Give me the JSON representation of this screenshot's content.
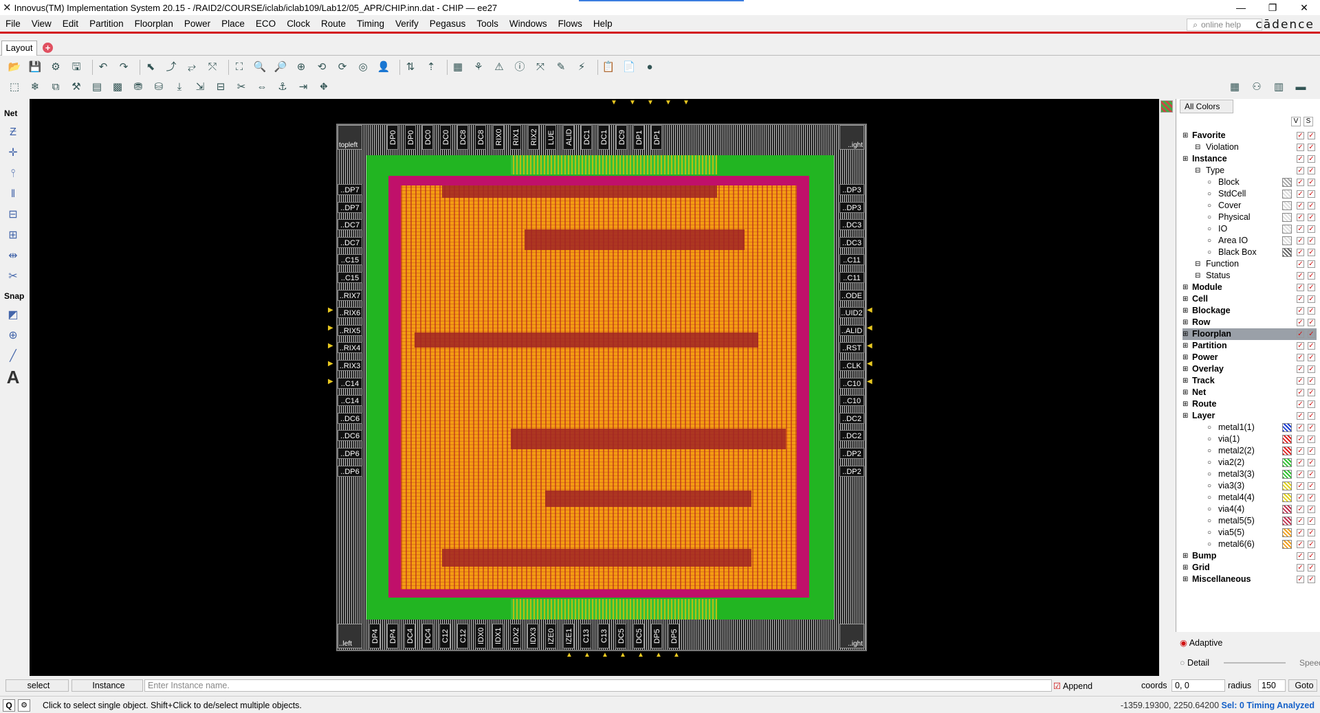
{
  "title": "Innovus(TM) Implementation System 20.15 - /RAID2/COURSE/iclab/iclab109/Lab12/05_APR/CHIP.inn.dat - CHIP — ee27",
  "window_controls": [
    "—",
    "❐",
    "✕"
  ],
  "menu": [
    "File",
    "View",
    "Edit",
    "Partition",
    "Floorplan",
    "Power",
    "Place",
    "ECO",
    "Clock",
    "Route",
    "Timing",
    "Verify",
    "Pegasus",
    "Tools",
    "Windows",
    "Flows",
    "Help"
  ],
  "search_placeholder": "online help",
  "brand": "cādence",
  "tab_label": "Layout",
  "left_labels": {
    "net": "Net",
    "snap": "Snap",
    "text": "A"
  },
  "pads": {
    "top": [
      "DP0",
      "DP0",
      "DC0",
      "DC0",
      "DC8",
      "DC8",
      "RIX0",
      "RIX1",
      "RIX2",
      "LUE",
      "ALID",
      "DC1",
      "DC1",
      "DC9",
      "DP1",
      "DP1"
    ],
    "bottom": [
      "DP4",
      "DP4",
      "DC4",
      "DC4",
      "C12",
      "C12",
      "IDX0",
      "IDX1",
      "IDX2",
      "IDX3",
      "IZE0",
      "IZE1",
      "C13",
      "C13",
      "DC5",
      "DC5",
      "DP5",
      "DP5"
    ],
    "left": [
      "..DP7",
      "..DP7",
      "..DC7",
      "..DC7",
      "..C15",
      "..C15",
      "..RIX7",
      "..RIX6",
      "..RIX5",
      "..RIX4",
      "..RIX3",
      "..C14",
      "..C14",
      "..DC6",
      "..DC6",
      "..DP6",
      "..DP6"
    ],
    "right": [
      "..DP3",
      "..DP3",
      "..DC3",
      "..DC3",
      "..C11",
      "..C11",
      "..ODE",
      "..UID2",
      "..ALID",
      "..RST",
      "..CLK",
      "..C10",
      "..C10",
      "..DC2",
      "..DC2",
      "..DP2",
      "..DP2"
    ],
    "corners": {
      "tl": "topleft",
      "tr": "..ight",
      "bl": "..left",
      "br": "..ight"
    }
  },
  "right_panel": {
    "all_colors": "All Colors",
    "vs": [
      "V",
      "S"
    ],
    "tree": [
      {
        "label": "Favorite",
        "bold": true,
        "lvl": 0
      },
      {
        "label": "Violation",
        "lvl": 1
      },
      {
        "label": "Instance",
        "bold": true,
        "lvl": 0
      },
      {
        "label": "Type",
        "lvl": 1
      },
      {
        "label": "Block",
        "lvl": 2
      },
      {
        "label": "StdCell",
        "lvl": 2
      },
      {
        "label": "Cover",
        "lvl": 2
      },
      {
        "label": "Physical",
        "lvl": 2
      },
      {
        "label": "IO",
        "lvl": 2
      },
      {
        "label": "Area IO",
        "lvl": 2
      },
      {
        "label": "Black Box",
        "lvl": 2
      },
      {
        "label": "Function",
        "lvl": 1
      },
      {
        "label": "Status",
        "lvl": 1
      },
      {
        "label": "Module",
        "bold": true,
        "lvl": 0
      },
      {
        "label": "Cell",
        "bold": true,
        "lvl": 0
      },
      {
        "label": "Blockage",
        "bold": true,
        "lvl": 0
      },
      {
        "label": "Row",
        "bold": true,
        "lvl": 0
      },
      {
        "label": "Floorplan",
        "bold": true,
        "lvl": 0
      },
      {
        "label": "Partition",
        "bold": true,
        "lvl": 0
      },
      {
        "label": "Power",
        "bold": true,
        "lvl": 0
      },
      {
        "label": "Overlay",
        "bold": true,
        "lvl": 0
      },
      {
        "label": "Track",
        "bold": true,
        "lvl": 0
      },
      {
        "label": "Net",
        "bold": true,
        "lvl": 0
      },
      {
        "label": "Route",
        "bold": true,
        "lvl": 0
      },
      {
        "label": "Layer",
        "bold": true,
        "lvl": 0
      },
      {
        "label": "metal1(1)",
        "lvl": 2
      },
      {
        "label": "via(1)",
        "lvl": 2
      },
      {
        "label": "metal2(2)",
        "lvl": 2
      },
      {
        "label": "via2(2)",
        "lvl": 2
      },
      {
        "label": "metal3(3)",
        "lvl": 2
      },
      {
        "label": "via3(3)",
        "lvl": 2
      },
      {
        "label": "metal4(4)",
        "lvl": 2
      },
      {
        "label": "via4(4)",
        "lvl": 2
      },
      {
        "label": "metal5(5)",
        "lvl": 2
      },
      {
        "label": "via5(5)",
        "lvl": 2
      },
      {
        "label": "metal6(6)",
        "lvl": 2
      },
      {
        "label": "Bump",
        "bold": true,
        "lvl": 0
      },
      {
        "label": "Grid",
        "bold": true,
        "lvl": 0
      },
      {
        "label": "Miscellaneous",
        "bold": true,
        "lvl": 0
      }
    ],
    "adaptive": "Adaptive",
    "detail": "Detail",
    "speed": "Speed"
  },
  "status": {
    "mode": "select",
    "obj": "Instance",
    "input_placeholder": "Enter Instance name.",
    "append": "Append",
    "coords_label": "coords",
    "coords_value": "0, 0",
    "radius_label": "radius",
    "radius_value": "150",
    "goto": "Goto"
  },
  "msg": {
    "q": "Q",
    "text": "Click to select single object. Shift+Click to de/select multiple objects.",
    "coords": "-1359.19300, 2250.64200",
    "sel": "Sel: 0",
    "timing": "Timing Analyzed"
  }
}
